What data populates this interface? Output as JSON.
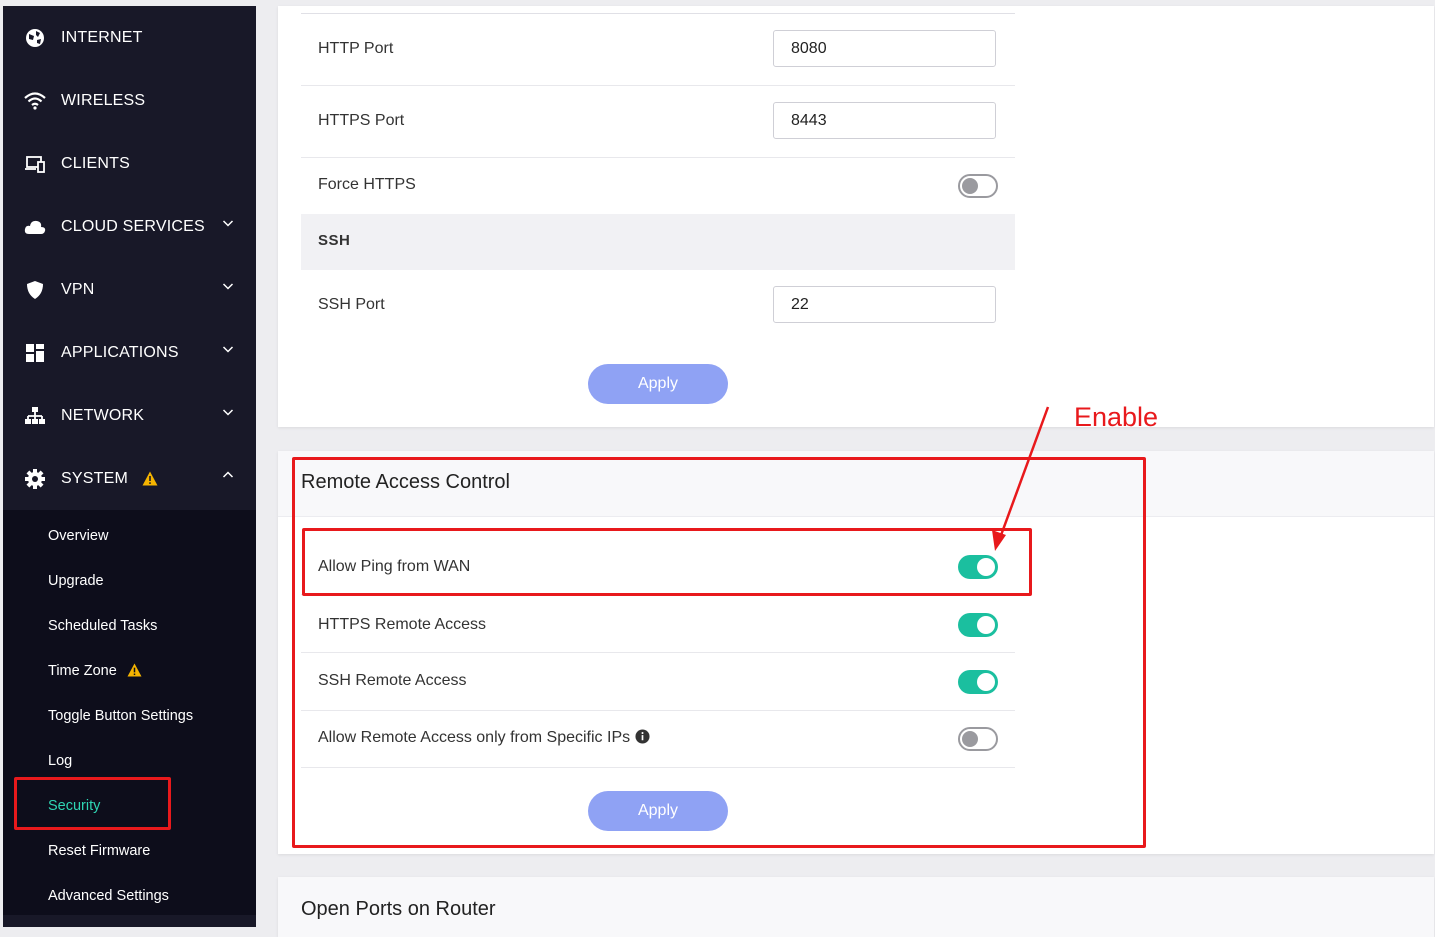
{
  "sidebar": {
    "nav_items": [
      {
        "label": "INTERNET",
        "icon": "globe-icon"
      },
      {
        "label": "WIRELESS",
        "icon": "wifi-icon"
      },
      {
        "label": "CLIENTS",
        "icon": "devices-icon"
      },
      {
        "label": "CLOUD SERVICES",
        "icon": "cloud-icon",
        "chevron": "chevron-down-icon"
      },
      {
        "label": "VPN",
        "icon": "shield-icon",
        "chevron": "chevron-down-icon"
      },
      {
        "label": "APPLICATIONS",
        "icon": "apps-grid-icon",
        "chevron": "chevron-down-icon"
      },
      {
        "label": "NETWORK",
        "icon": "network-icon",
        "chevron": "chevron-down-icon"
      },
      {
        "label": "SYSTEM",
        "icon": "gear-icon",
        "chevron": "chevron-up-icon",
        "badge_icon": "warning-icon"
      }
    ],
    "system_sub_items": [
      {
        "label": "Overview"
      },
      {
        "label": "Upgrade"
      },
      {
        "label": "Scheduled Tasks"
      },
      {
        "label": "Time Zone",
        "badge_icon": "warning-icon"
      },
      {
        "label": "Toggle Button Settings"
      },
      {
        "label": "Log"
      },
      {
        "label": "Security",
        "active": true
      },
      {
        "label": "Reset Firmware"
      },
      {
        "label": "Advanced Settings"
      }
    ]
  },
  "ports_card": {
    "http_port": {
      "label": "HTTP Port",
      "value": "8080"
    },
    "https_port": {
      "label": "HTTPS Port",
      "value": "8443"
    },
    "force_https": {
      "label": "Force HTTPS",
      "enabled": false
    },
    "ssh_section_title": "SSH",
    "ssh_port": {
      "label": "SSH Port",
      "value": "22"
    },
    "apply_label": "Apply"
  },
  "remote_access_card": {
    "title": "Remote Access Control",
    "rows": [
      {
        "label": "Allow Ping from WAN",
        "enabled": true
      },
      {
        "label": "HTTPS Remote Access",
        "enabled": true
      },
      {
        "label": "SSH Remote Access",
        "enabled": true
      },
      {
        "label": "Allow Remote Access only from Specific IPs",
        "enabled": false,
        "info_icon": "info-icon"
      }
    ],
    "apply_label": "Apply"
  },
  "open_ports_card": {
    "title": "Open Ports on Router"
  },
  "annotation": {
    "text": "Enable",
    "color": "#e8191c"
  },
  "colors": {
    "sidebar_bg": "#181828",
    "submenu_bg": "#0d0d1b",
    "active_submenu": "#2fd5b3",
    "toggle_on": "#1bbf9f",
    "apply_button": "#8fa2f4",
    "warning": "#f5b400"
  }
}
